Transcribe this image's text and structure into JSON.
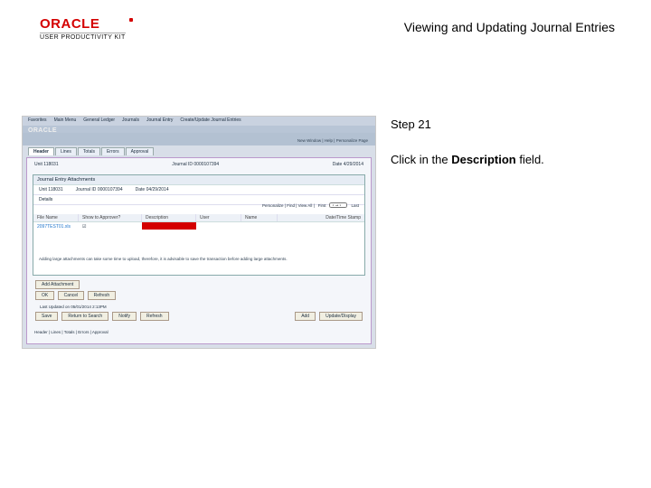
{
  "brand": {
    "name": "ORACLE",
    "kit": "USER PRODUCTIVITY KIT"
  },
  "doc_title": "Viewing and Updating Journal Entries",
  "step": {
    "label": "Step 21",
    "text_pre": "Click in the ",
    "bold": "Description",
    "text_post": " field."
  },
  "screenshot": {
    "nav": [
      "Favorites",
      "Main Menu",
      "General Ledger",
      "Journals",
      "Journal Entry",
      "Create/Update Journal Entries"
    ],
    "oracle": "ORACLE",
    "userline": "New Window | Help | Personalize Page",
    "tabs": [
      "Header",
      "Lines",
      "Totals",
      "Errors",
      "Approval"
    ],
    "row1": {
      "unit_l": "Unit",
      "unit_v": "118031",
      "jid_l": "Journal ID",
      "jid_v": "0000107394",
      "date_l": "Date",
      "date_v": "4/29/2014"
    },
    "modal": {
      "title": "Journal Entry Attachments",
      "row": {
        "unit_l": "Unit",
        "unit_v": "118031",
        "jid_l": "Journal ID",
        "jid_v": "0000107394",
        "date_l": "Date",
        "date_v": "04/29/2014"
      },
      "details": "Details",
      "customize": {
        "label": "Personalize | Find | View All |",
        "first": "First",
        "range": "1 of 1",
        "last": "Last"
      },
      "cols": [
        "File Name",
        "Show to Approver?",
        "Description",
        "User",
        "Name",
        "Date/Time Stamp"
      ],
      "data": {
        "file": "2097TEST01.xls",
        "appr": "☑"
      },
      "hint": "Adding large attachments can take some time to upload, therefore, it is advisable to save the transaction before adding large attachments.",
      "btn_add": "Add Attachment",
      "btn_ok": "OK",
      "btn_cancel": "Cancel",
      "btn_refresh": "Refresh",
      "last_updated_l": "Last Updated on",
      "last_updated_v": "05/01/2014 2:13PM"
    },
    "bottom": {
      "save": "Save",
      "ret": "Return to Search",
      "notify": "Notify",
      "refresh": "Refresh",
      "add": "Add",
      "upd": "Update/Display"
    },
    "footer": "Header | Lines | Totals | Errors | Approval"
  }
}
